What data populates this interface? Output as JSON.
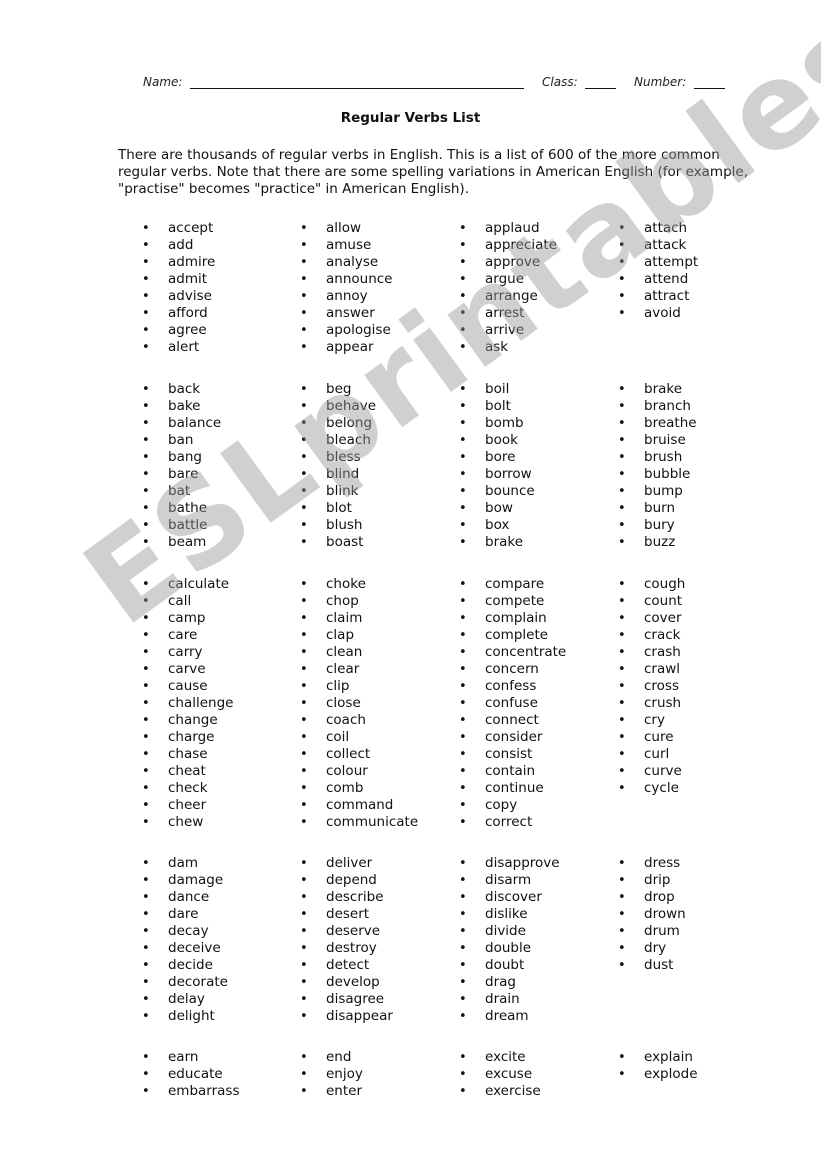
{
  "header": {
    "name_label": "Name:",
    "class_label": "Class:",
    "number_label": "Number:"
  },
  "title": "Regular Verbs List",
  "intro": "There are thousands of regular verbs in English. This is a list of 600 of the more common regular verbs. Note that there are some spelling variations in American English (for example, \"practise\" becomes \"practice\" in American English).",
  "watermark": "ESLprintables.com",
  "groups": [
    {
      "columns": [
        [
          "accept",
          "add",
          "admire",
          "admit",
          "advise",
          "afford",
          "agree",
          "alert"
        ],
        [
          "allow",
          "amuse",
          "analyse",
          "announce",
          "annoy",
          "answer",
          "apologise",
          "appear"
        ],
        [
          "applaud",
          "appreciate",
          "approve",
          "argue",
          "arrange",
          "arrest",
          "arrive",
          "ask"
        ],
        [
          "attach",
          "attack",
          "attempt",
          "attend",
          "attract",
          "avoid"
        ]
      ]
    },
    {
      "columns": [
        [
          "back",
          "bake",
          "balance",
          "ban",
          "bang",
          "bare",
          "bat",
          "bathe",
          "battle",
          "beam"
        ],
        [
          "beg",
          "behave",
          "belong",
          "bleach",
          "bless",
          "blind",
          "blink",
          "blot",
          "blush",
          "boast"
        ],
        [
          "boil",
          "bolt",
          "bomb",
          "book",
          "bore",
          "borrow",
          "bounce",
          "bow",
          "box",
          "brake"
        ],
        [
          "brake",
          "branch",
          "breathe",
          "bruise",
          "brush",
          "bubble",
          "bump",
          "burn",
          "bury",
          "buzz"
        ]
      ]
    },
    {
      "columns": [
        [
          "calculate",
          "call",
          "camp",
          "care",
          "carry",
          "carve",
          "cause",
          "challenge",
          "change",
          "charge",
          "chase",
          "cheat",
          "check",
          "cheer",
          "chew"
        ],
        [
          "choke",
          "chop",
          "claim",
          "clap",
          "clean",
          "clear",
          "clip",
          "close",
          "coach",
          "coil",
          "collect",
          "colour",
          "comb",
          "command",
          "communicate"
        ],
        [
          "compare",
          "compete",
          "complain",
          "complete",
          "concentrate",
          "concern",
          "confess",
          "confuse",
          "connect",
          "consider",
          "consist",
          "contain",
          "continue",
          "copy",
          "correct"
        ],
        [
          "cough",
          "count",
          "cover",
          "crack",
          "crash",
          "crawl",
          "cross",
          "crush",
          "cry",
          "cure",
          "curl",
          "curve",
          "cycle"
        ]
      ]
    },
    {
      "columns": [
        [
          "dam",
          "damage",
          "dance",
          "dare",
          "decay",
          "deceive",
          "decide",
          "decorate",
          "delay",
          "delight"
        ],
        [
          "deliver",
          "depend",
          "describe",
          "desert",
          "deserve",
          "destroy",
          "detect",
          "develop",
          "disagree",
          "disappear"
        ],
        [
          "disapprove",
          "disarm",
          "discover",
          "dislike",
          "divide",
          "double",
          "doubt",
          "drag",
          "drain",
          "dream"
        ],
        [
          "dress",
          "drip",
          "drop",
          "drown",
          "drum",
          "dry",
          "dust"
        ]
      ]
    },
    {
      "columns": [
        [
          "earn",
          "educate",
          "embarrass"
        ],
        [
          "end",
          "enjoy",
          "enter"
        ],
        [
          "excite",
          "excuse",
          "exercise"
        ],
        [
          "explain",
          "explode"
        ]
      ]
    }
  ]
}
